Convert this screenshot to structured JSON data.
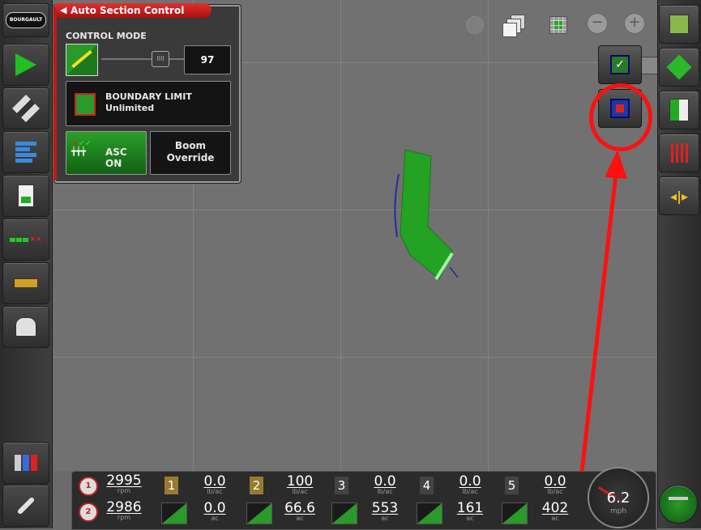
{
  "left_bar": {
    "logo_text": "BOURGAULT",
    "items": [
      "guidance-arrow",
      "gps-satellite",
      "section-bars",
      "report-page",
      "section-status",
      "implement-bar",
      "tank-vehicle",
      "bins",
      "settings-wrench"
    ]
  },
  "asc_panel": {
    "title": "Auto Section Control",
    "control_mode_label": "CONTROL MODE",
    "control_mode_value": "97",
    "boundary_label": "BOUNDARY LIMIT",
    "boundary_value": "Unlimited",
    "asc_toggle_label": "ASC ON",
    "boom_override_label_1": "Boom",
    "boom_override_label_2": "Override"
  },
  "status_bar": {
    "engine1": {
      "value": "2995",
      "unit": "rpm",
      "badge": "1"
    },
    "engine2": {
      "value": "2986",
      "unit": "rpm",
      "badge": "2"
    },
    "products": [
      {
        "num": "1",
        "rate": "0.0",
        "rate_unit": "lb/ac",
        "area": "0.0",
        "area_unit": "ac",
        "color": "#9a7a30"
      },
      {
        "num": "2",
        "rate": "100",
        "rate_unit": "lb/ac",
        "area": "66.6",
        "area_unit": "ac",
        "color": "#9a7a30"
      },
      {
        "num": "3",
        "rate": "0.0",
        "rate_unit": "lb/ac",
        "area": "553",
        "area_unit": "ac",
        "color": "#444444"
      },
      {
        "num": "4",
        "rate": "0.0",
        "rate_unit": "lb/ac",
        "area": "161",
        "area_unit": "ac",
        "color": "#444444"
      },
      {
        "num": "5",
        "rate": "0.0",
        "rate_unit": "lb/ac",
        "area": "402",
        "area_unit": "ac",
        "color": "#444444"
      }
    ],
    "speed": "6.2",
    "speed_unit": "mph"
  },
  "colors": {
    "accent_red": "#d01818",
    "field_green": "#22a022",
    "annotation": "#ff1010"
  }
}
